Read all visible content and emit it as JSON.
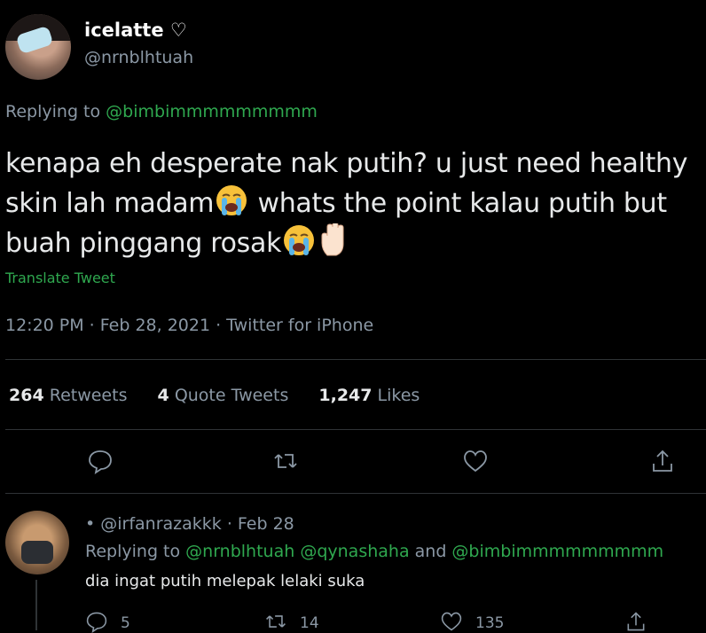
{
  "tweet": {
    "name": "icelatte ♡",
    "handle": "@nrnblhtuah",
    "replying_prefix": "Replying to ",
    "replying_to": "@bimbimmmmmmmmm",
    "text_part1": "kenapa eh desperate nak putih? u just need healthy skin lah madam",
    "text_part2": " whats the point kalau putih but buah pinggang rosak",
    "translate": "Translate Tweet",
    "time": "12:20 PM · Feb 28, 2021 · Twitter for iPhone",
    "retweets_count": "264",
    "retweets_label": "Retweets",
    "quotes_count": "4",
    "quotes_label": "Quote Tweets",
    "likes_count": "1,247",
    "likes_label": "Likes"
  },
  "reply": {
    "header": "• @irfanrazakkk · Feb 28",
    "replying_prefix": "Replying to ",
    "replying_user1": "@nrnblhtuah",
    "replying_user2": "@qynashaha",
    "replying_and": " and ",
    "replying_user3": "@bimbimmmmmmmmm",
    "text": "dia ingat putih melepak lelaki suka",
    "reply_count": "5",
    "retweet_count": "14",
    "like_count": "135"
  },
  "icons": [
    "reply-icon",
    "retweet-icon",
    "like-icon",
    "share-icon",
    "loudly-crying-emoji",
    "raised-hand-emoji"
  ],
  "colors": {
    "accent": "#2fa84f",
    "muted": "#8b98a5",
    "text": "#e7e9ea",
    "divider": "#2f3336"
  }
}
